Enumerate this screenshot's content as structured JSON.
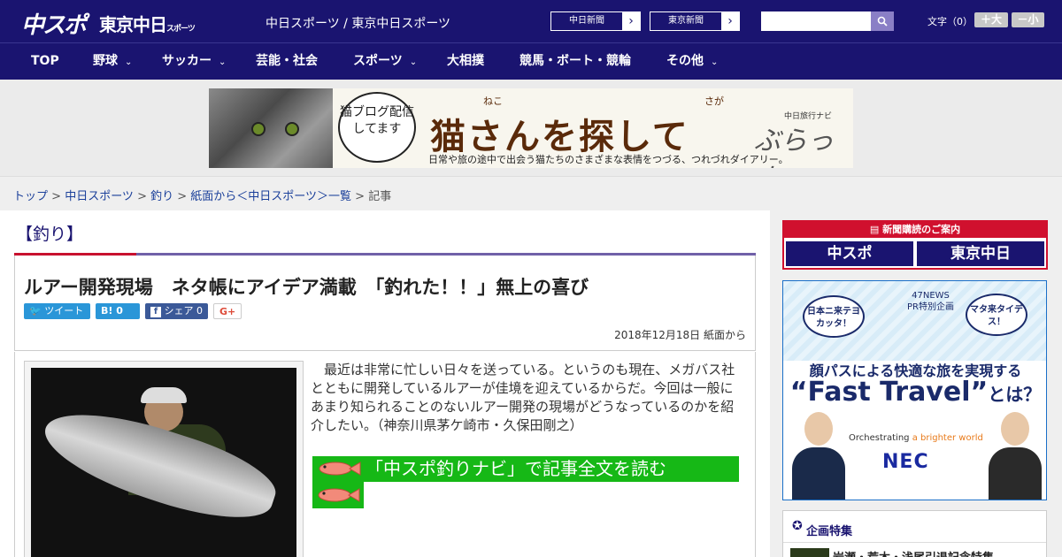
{
  "header": {
    "logo_main": "中スポ",
    "logo_tokyo": "東京中日",
    "logo_tokyo_suffix": "スポーツ",
    "site_names": "中日スポーツ / 東京中日スポーツ",
    "link_chunichi": "中日新聞",
    "link_tokyo": "東京新聞",
    "arrow": "›",
    "search_placeholder": "",
    "search_icon": "search-icon",
    "font_size_label": "文字（0）",
    "font_larger": "＋大",
    "font_smaller": "－小"
  },
  "nav": {
    "items": [
      "TOP",
      "野球",
      "サッカー",
      "芸能・社会",
      "スポーツ",
      "大相撲",
      "競馬・ボート・競輪",
      "その他"
    ],
    "chevron": "⌄"
  },
  "banner": {
    "bubble": "猫ブログ配信してます",
    "ruby_neko": "ねこ",
    "ruby_saga": "さが",
    "title": "猫さんを探して",
    "brand_small": "中日旅行ナビ",
    "brand": "ぶらっ人",
    "subtitle": "日常や旅の途中で出会う猫たちのさまざまな表情をつづる、つれづれダイアリー。"
  },
  "breadcrumb": {
    "items": [
      "トップ",
      "中日スポーツ",
      "釣り",
      "紙面から＜中日スポーツ＞一覧"
    ],
    "separator": " > ",
    "current": "記事"
  },
  "article": {
    "category": "【釣り】",
    "headline": "ルアー開発現場　ネタ帳にアイデア満載　「釣れた！！」無上の喜び",
    "share_tweet": "ツイート",
    "share_hatena": "B! 0",
    "share_fb": "シェア 0",
    "share_gplus": "G+",
    "date": "2018年12月18日 紙面から",
    "lead": "最近は非常に忙しい日々を送っている。というのも現在、メガバス社とともに開発しているルアーが佳境を迎えているからだ。今回は一般にあまり知られることのないルアー開発の現場がどうなっているのかを紹介したい。（神奈川県茅ケ崎市・久保田剛之）",
    "cta": "「中スポ釣りナビ」で記事全文を読む",
    "colors": {
      "accent_red": "#c8102e",
      "accent_purple": "#7060a8",
      "cta_green": "#16b816",
      "brand_navy": "#1a1470"
    }
  },
  "sidebar": {
    "subscribe_head": "新聞購読のご案内",
    "subscribe_logo1": "中スポ",
    "subscribe_logo2": "東京中日",
    "ad": {
      "bubble_left": "日本ニ来テヨカッタ！",
      "bubble_right": "マタ来タイデス！",
      "header_47": "47NEWS",
      "header_pr": "PR特別企画",
      "line1": "顔パスによる快適な旅を実現する",
      "line2_main": "“Fast Travel”",
      "line2_suffix": "とは？",
      "orchestrating": "Orchestrating",
      "orchestrating_tail": " a brighter world",
      "nec": "NEC"
    },
    "feature_head": "企画特集",
    "feature_item": "岩瀬・荒木・浅尾引退記念特集"
  }
}
